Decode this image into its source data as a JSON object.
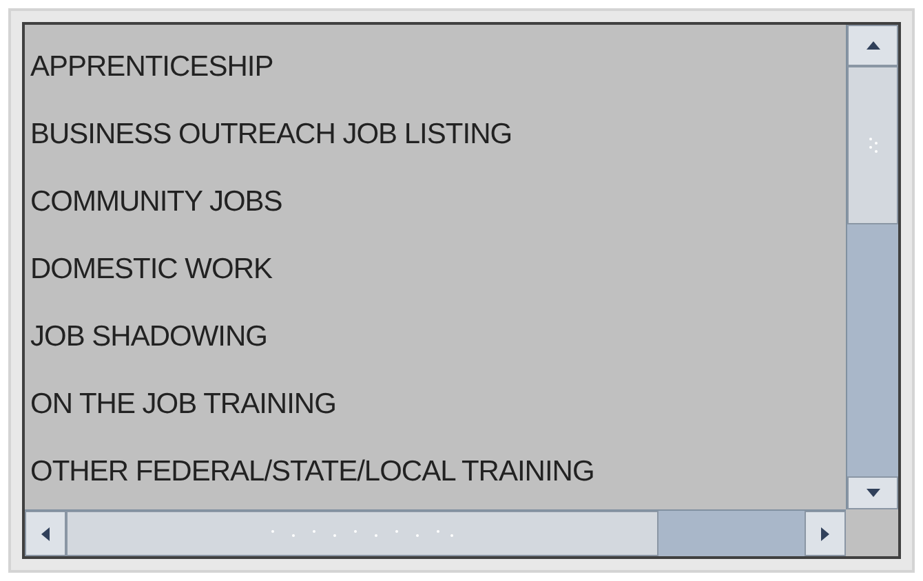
{
  "list": {
    "items": [
      "APPRENTICESHIP",
      "BUSINESS OUTREACH JOB LISTING",
      "COMMUNITY JOBS",
      "DOMESTIC WORK",
      "JOB SHADOWING",
      "ON THE JOB TRAINING",
      "OTHER FEDERAL/STATE/LOCAL TRAINING"
    ]
  }
}
